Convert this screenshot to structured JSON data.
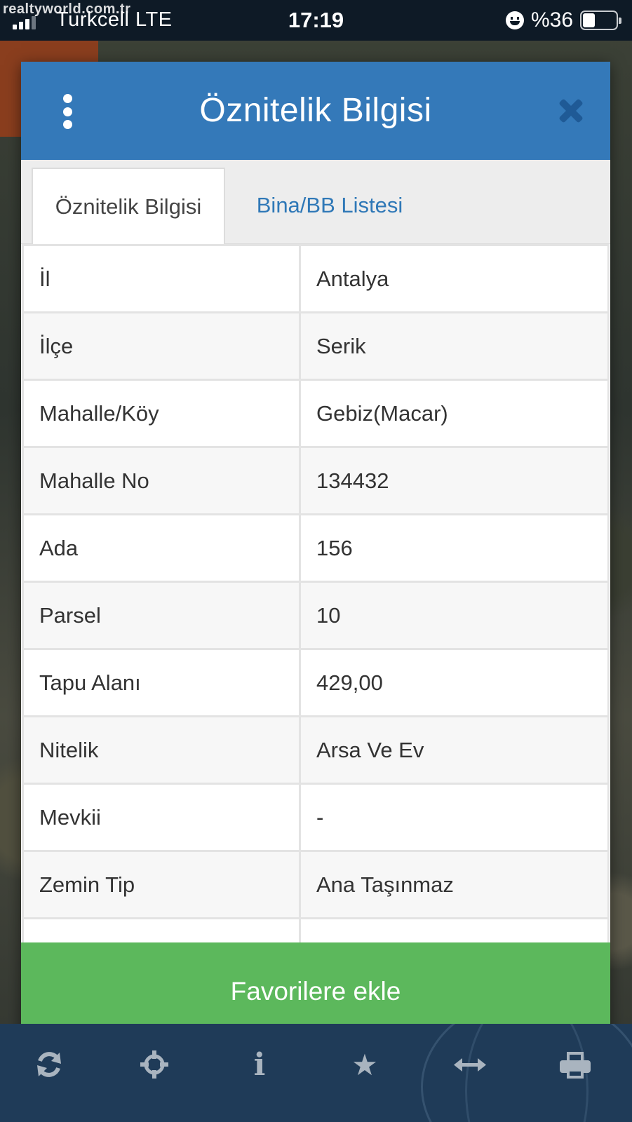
{
  "status_bar": {
    "watermark": "realtyworld.com.tr",
    "carrier": "Turkcell  LTE",
    "time": "17:19",
    "battery_percent": "%36",
    "battery_level": 0.36
  },
  "modal": {
    "title": "Öznitelik Bilgisi",
    "menu_icon": "vertical-dots-icon",
    "close_icon": "close-x-icon",
    "tabs": [
      {
        "label": "Öznitelik Bilgisi",
        "active": true
      },
      {
        "label": "Bina/BB Listesi",
        "active": false
      }
    ],
    "rows": [
      {
        "key": "İl",
        "value": "Antalya"
      },
      {
        "key": "İlçe",
        "value": "Serik"
      },
      {
        "key": "Mahalle/Köy",
        "value": "Gebiz(Macar)"
      },
      {
        "key": "Mahalle No",
        "value": "134432"
      },
      {
        "key": "Ada",
        "value": "156"
      },
      {
        "key": "Parsel",
        "value": "10"
      },
      {
        "key": "Tapu Alanı",
        "value": "429,00"
      },
      {
        "key": "Nitelik",
        "value": "Arsa Ve Ev"
      },
      {
        "key": "Mevkii",
        "value": "-"
      },
      {
        "key": "Zemin Tip",
        "value": "Ana Taşınmaz"
      }
    ],
    "favorite_button": "Favorilere ekle"
  },
  "toolbar": {
    "icons": [
      "refresh-icon",
      "crosshair-icon",
      "info-icon",
      "star-icon",
      "measure-arrows-icon",
      "print-icon"
    ]
  },
  "colors": {
    "header": "#3479b9",
    "tab_link": "#2f78b7",
    "favorite_button": "#5cb85c",
    "toolbar": "#1f3b58"
  }
}
